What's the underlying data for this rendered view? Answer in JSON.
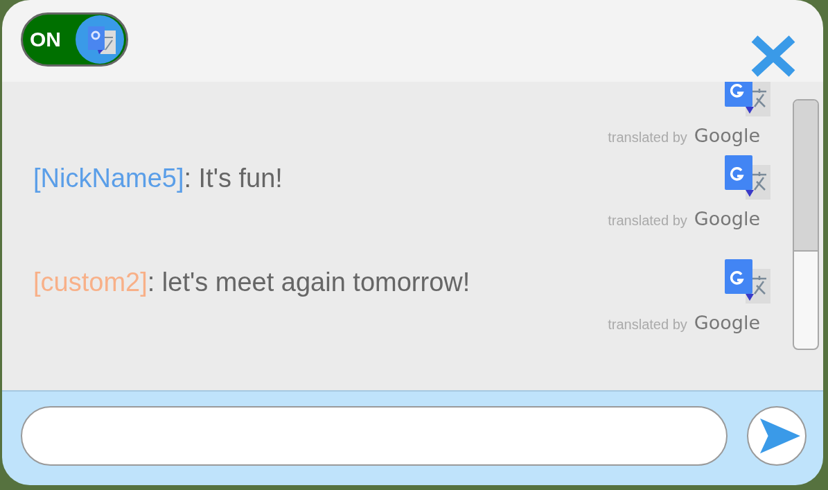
{
  "translate_toggle": {
    "label": "ON",
    "on": true
  },
  "messages": [
    {
      "kind": "cut",
      "credit": "translated by",
      "brand": "Google"
    },
    {
      "kind": "full",
      "sender": "[NickName5]",
      "color": "#5a9ee8",
      "text": ": It's fun!",
      "credit": "translated by",
      "brand": "Google"
    },
    {
      "kind": "full",
      "sender": "[custom2]",
      "color": "#f8b088",
      "text": ": let's meet again tomorrow!",
      "credit": "translated by",
      "brand": "Google"
    }
  ]
}
